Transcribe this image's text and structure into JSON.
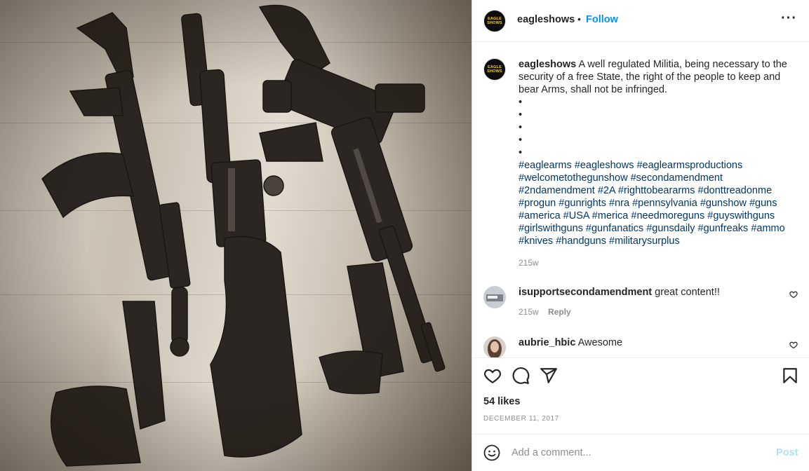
{
  "post": {
    "image_alt_icon": "firearms-photo",
    "username": "eagleshows",
    "avatar_text_line1": "EAGLE",
    "avatar_text_line2": "SHOWS",
    "follow_label": "Follow",
    "more_label": "···",
    "caption_user": "eagleshows",
    "caption_text": "A well regulated Militia, being necessary to the security of a free State, the right of the people to keep and bear Arms, shall not be infringed.",
    "bullets": [
      "•",
      "•",
      "•",
      "•",
      "•"
    ],
    "hashtags": [
      "#eaglearms",
      "#eagleshows",
      "#eaglearmsproductions",
      "#welcometothegunshow",
      "#secondamendment",
      "#2ndamendment",
      "#2A",
      "#righttobeararms",
      "#donttreadonme",
      "#progun",
      "#gunrights",
      "#nra",
      "#pennsylvania",
      "#gunshow",
      "#guns",
      "#america",
      "#USA",
      "#merica",
      "#needmoreguns",
      "#guyswithguns",
      "#girlswithguns",
      "#gunfanatics",
      "#gunsdaily",
      "#gunfreaks",
      "#ammo",
      "#knives",
      "#handguns",
      "#militarysurplus"
    ],
    "caption_time": "215w",
    "comments": [
      {
        "user": "isupportsecondamendment",
        "text": "great content!!",
        "time": "215w",
        "reply_label": "Reply"
      },
      {
        "user": "aubrie_hbic",
        "text": "Awesome"
      }
    ],
    "likes": "54 likes",
    "date": "DECEMBER 11, 2017",
    "add_comment_placeholder": "Add a comment...",
    "post_label": "Post"
  },
  "colors": {
    "link_blue": "#0095f6",
    "hashtag_blue": "#00376b",
    "post_disabled": "#b2dffc",
    "muted": "#8e8e8e",
    "avatar_yellow": "#ffd400"
  }
}
